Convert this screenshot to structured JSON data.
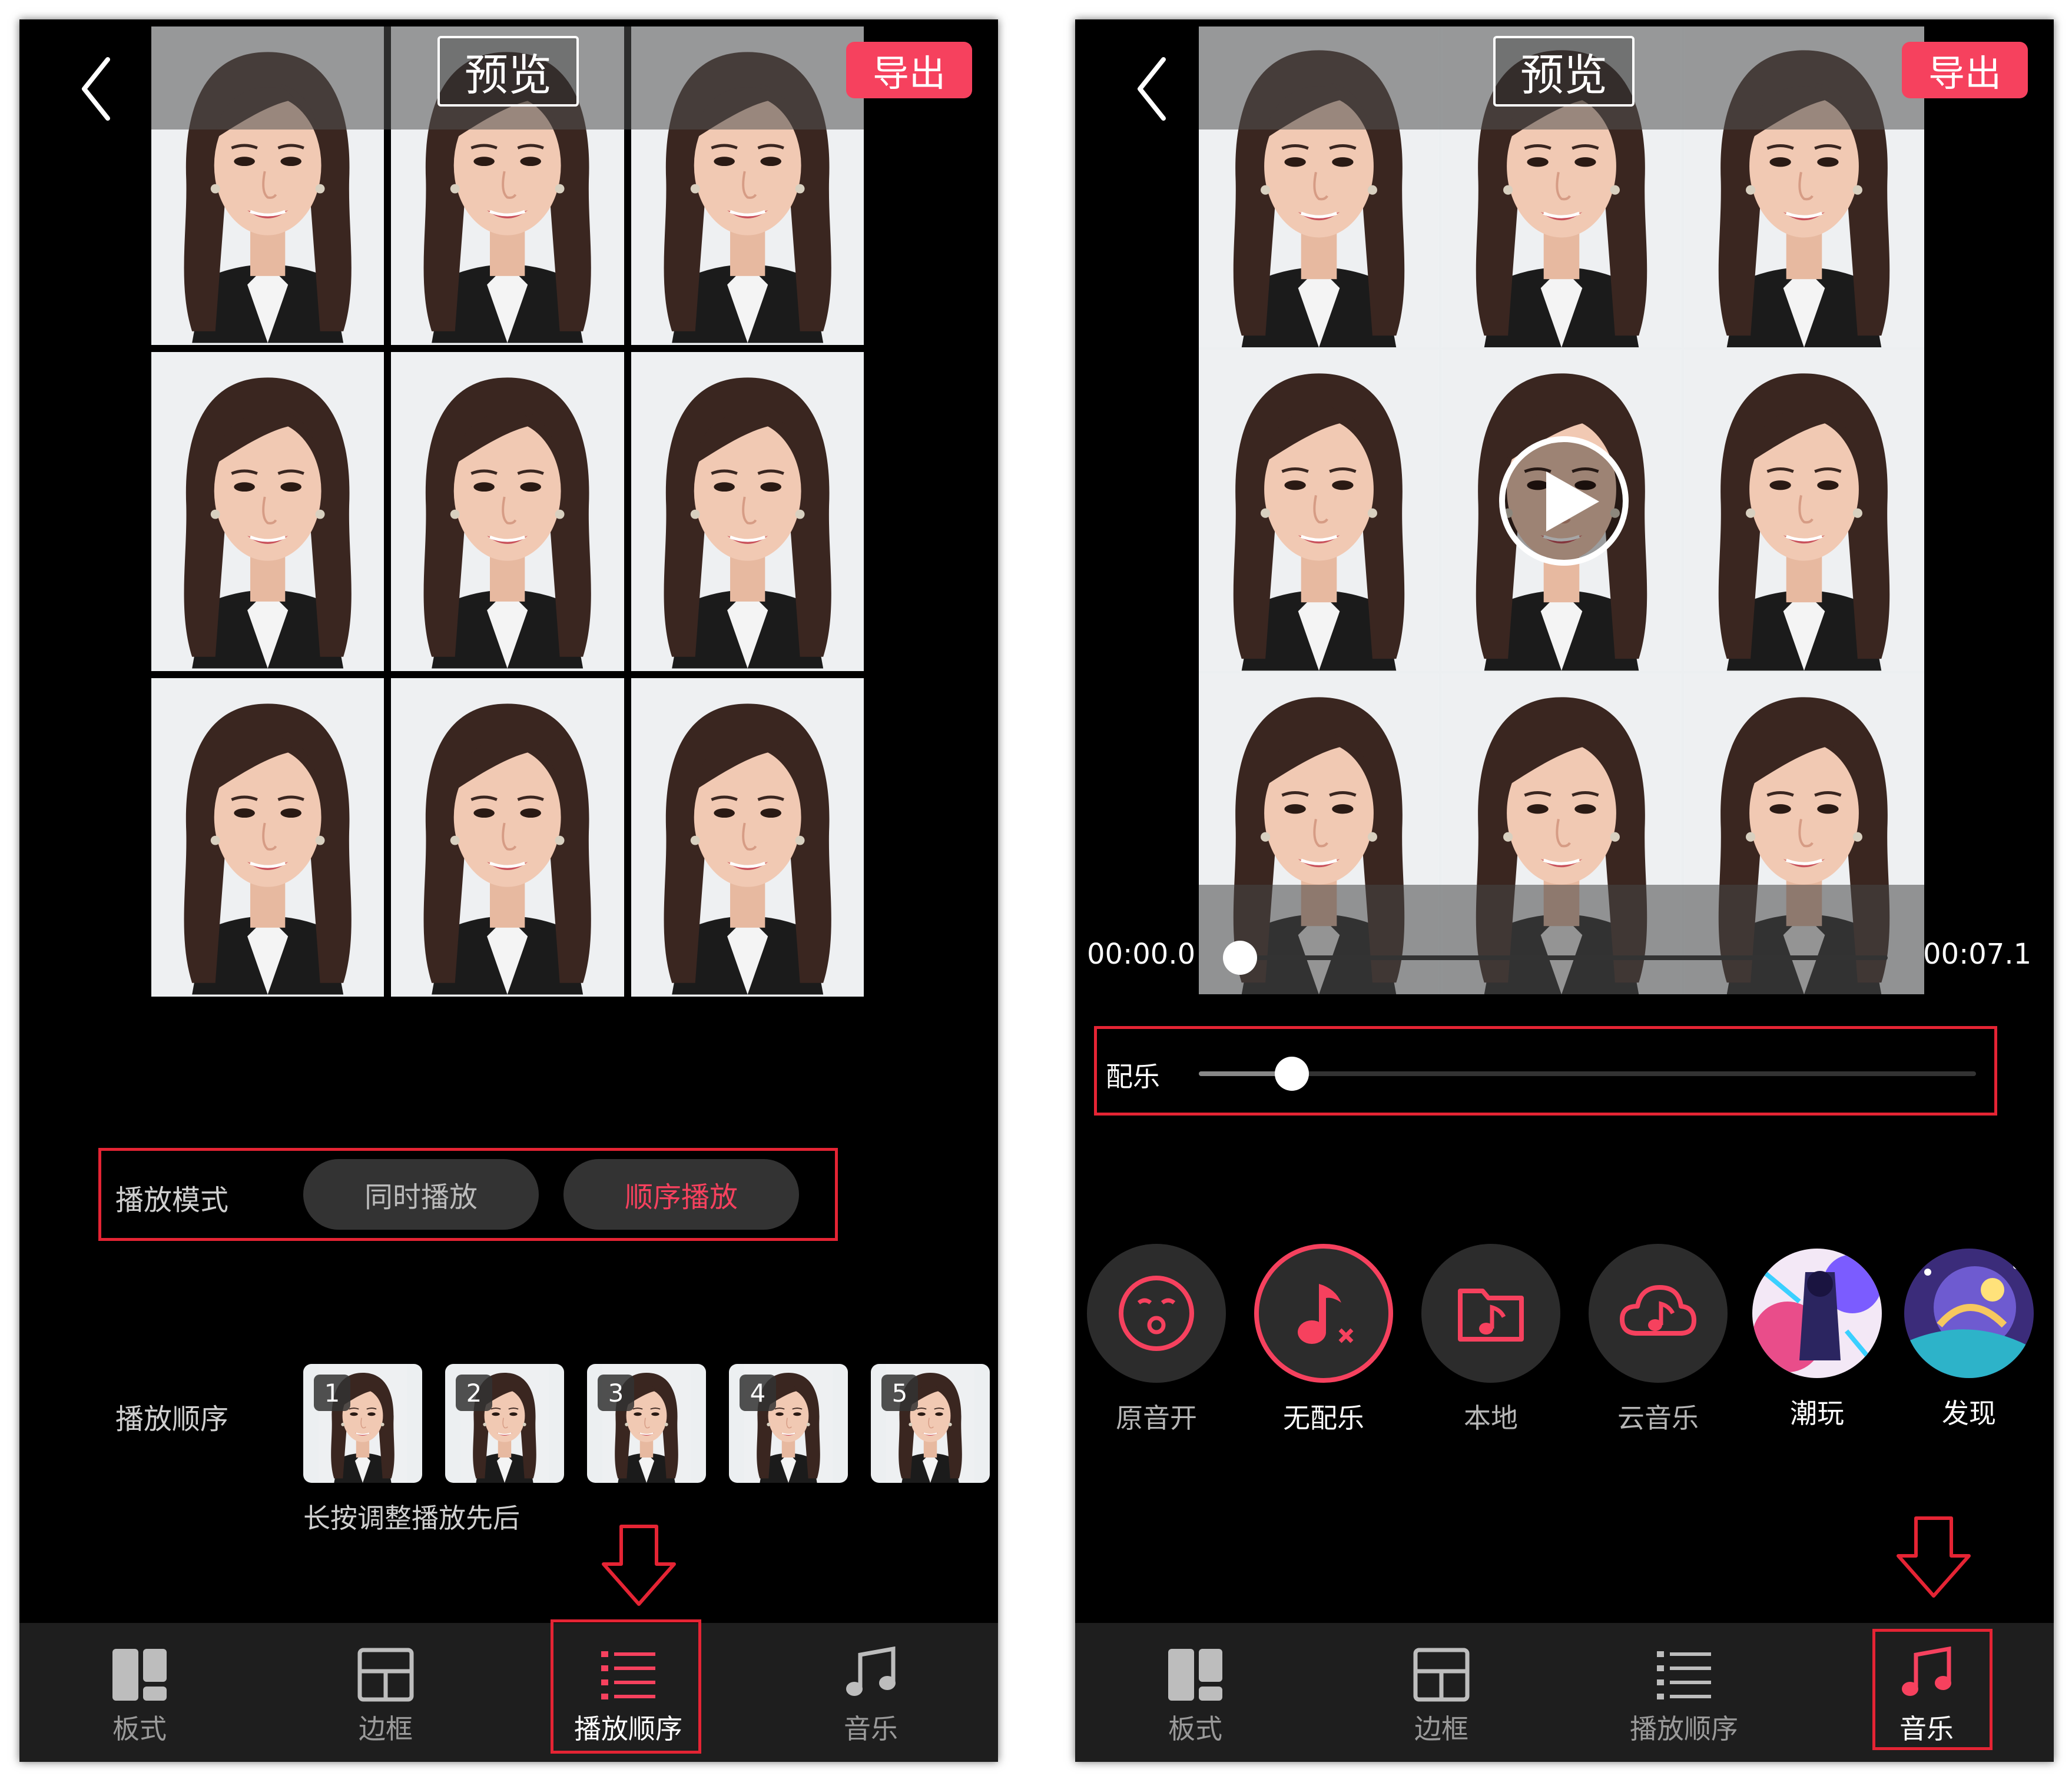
{
  "header": {
    "back": "<",
    "title": "预览",
    "export_label": "导出"
  },
  "left": {
    "mode_label": "播放模式",
    "mode_options": [
      "同时播放",
      "顺序播放"
    ],
    "selected_mode": "顺序播放",
    "order_label": "播放顺序",
    "thumb_numbers": [
      "1",
      "2",
      "3",
      "4",
      "5"
    ],
    "hint": "长按调整播放先后",
    "active_tab": "播放顺序"
  },
  "right": {
    "time_start": "00:00.0",
    "time_end": "00:07.1",
    "playback_progress": 0.0,
    "bgm_label": "配乐",
    "bgm_volume": 0.12,
    "music_options": [
      "原音开",
      "无配乐",
      "本地",
      "云音乐",
      "潮玩",
      "发现"
    ],
    "selected_music": "无配乐",
    "active_tab": "音乐"
  },
  "tabs": [
    "板式",
    "边框",
    "播放顺序",
    "音乐"
  ],
  "colors": {
    "accent": "#f6415e",
    "frame": "#e52434",
    "background": "#000000",
    "tabbar": "#1e1e1e"
  },
  "icons": [
    "back-icon",
    "play-icon",
    "layout-icon",
    "frame-icon",
    "list-icon",
    "music-note-icon",
    "mouth-icon",
    "no-music-icon",
    "folder-music-icon",
    "cloud-music-icon",
    "down-arrow-icon"
  ]
}
